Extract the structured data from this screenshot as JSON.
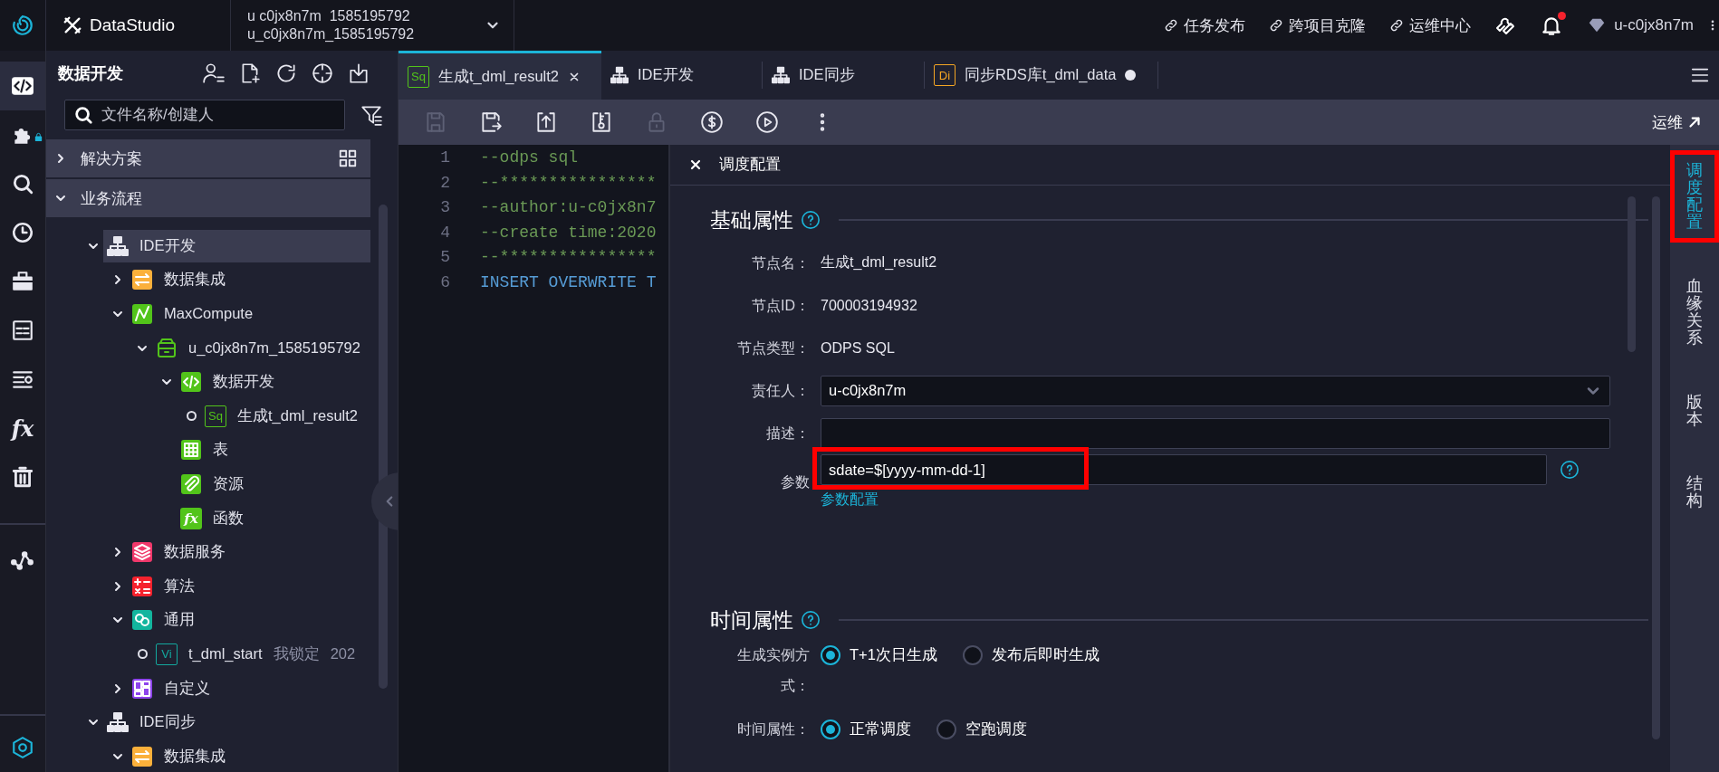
{
  "topbar": {
    "product": "DataStudio",
    "workspace": {
      "name": "u c0jx8n7m  1585195792",
      "id": "u_c0jx8n7m_1585195792"
    },
    "links": [
      {
        "label": "任务发布"
      },
      {
        "label": "跨项目克隆"
      },
      {
        "label": "运维中心"
      }
    ],
    "notification_unread": true,
    "user": "u-c0jx8n7m"
  },
  "rail": {
    "items": [
      {
        "kind": "code",
        "selected": true,
        "locked": false
      },
      {
        "kind": "plugin",
        "selected": false,
        "locked": true
      },
      {
        "kind": "search",
        "selected": false,
        "locked": false
      },
      {
        "kind": "clock",
        "selected": false,
        "locked": false
      },
      {
        "kind": "toolbox",
        "selected": false,
        "locked": false
      },
      {
        "kind": "table",
        "selected": false,
        "locked": false
      },
      {
        "kind": "list",
        "selected": false,
        "locked": false
      },
      {
        "kind": "function",
        "glyph": "fx",
        "selected": false,
        "locked": false
      },
      {
        "kind": "trash",
        "selected": false,
        "locked": false
      }
    ],
    "extra": [
      {
        "kind": "graph"
      }
    ],
    "bottom": [
      {
        "kind": "settings"
      }
    ]
  },
  "sidebar": {
    "title": "数据开发",
    "search": {
      "placeholder": "文件名称/创建人"
    },
    "sections": [
      {
        "label": "解决方案",
        "expanded": false
      },
      {
        "label": "业务流程",
        "expanded": true
      }
    ],
    "tree": [
      {
        "label": "IDE开发",
        "kind": "flow",
        "expanded": true,
        "selected": true,
        "children": [
          {
            "label": "数据集成",
            "kind": "integration",
            "expanded": false,
            "selected": false
          },
          {
            "label": "MaxCompute",
            "kind": "maxcompute",
            "expanded": true,
            "selected": false,
            "children": [
              {
                "label": "u_c0jx8n7m_1585195792",
                "kind": "database",
                "expanded": true,
                "selected": false,
                "children": [
                  {
                    "label": "数据开发",
                    "kind": "code",
                    "expanded": true,
                    "selected": false,
                    "children": [
                      {
                        "label": "生成t_dml_result2",
                        "kind": "file",
                        "badge": "Sq",
                        "color": "#52c41a",
                        "selected": false
                      }
                    ]
                  },
                  {
                    "label": "表",
                    "kind": "table",
                    "selected": false
                  },
                  {
                    "label": "资源",
                    "kind": "resource",
                    "selected": false
                  },
                  {
                    "label": "函数",
                    "kind": "function",
                    "glyph": "fx",
                    "selected": false
                  }
                ]
              }
            ]
          },
          {
            "label": "数据服务",
            "kind": "service",
            "expanded": false,
            "selected": false
          },
          {
            "label": "算法",
            "kind": "algorithm",
            "expanded": false,
            "selected": false
          },
          {
            "label": "通用",
            "kind": "general",
            "expanded": true,
            "selected": false,
            "children": [
              {
                "label": "t_dml_start",
                "kind": "file",
                "badge": "Vi",
                "color": "#13a89e",
                "lock_note": "我锁定",
                "date": "202",
                "selected": false
              }
            ]
          },
          {
            "label": "自定义",
            "kind": "custom",
            "expanded": false,
            "selected": false
          }
        ]
      },
      {
        "label": "IDE同步",
        "kind": "flow",
        "expanded": true,
        "selected": false,
        "children": [
          {
            "label": "数据集成",
            "kind": "integration",
            "expanded": true,
            "selected": false
          }
        ]
      }
    ]
  },
  "editor": {
    "tabs": [
      {
        "label": "生成t_dml_result2",
        "kind": "file",
        "badge": "Sq",
        "color": "#52c41a",
        "selected": true,
        "modified": false
      },
      {
        "label": "IDE开发",
        "kind": "flow",
        "selected": false,
        "modified": false
      },
      {
        "label": "IDE同步",
        "kind": "flow",
        "selected": false,
        "modified": false
      },
      {
        "label": "同步RDS库t_dml_data",
        "kind": "file",
        "badge": "Di",
        "color": "#f5a623",
        "selected": false,
        "modified": true
      }
    ],
    "toolbar": [
      {
        "kind": "save",
        "disabled": true
      },
      {
        "kind": "save-as",
        "disabled": false
      },
      {
        "kind": "submit",
        "disabled": false
      },
      {
        "kind": "key-file",
        "disabled": false
      },
      {
        "kind": "lock",
        "disabled": true
      },
      {
        "kind": "cost",
        "disabled": false
      },
      {
        "kind": "run",
        "disabled": false
      },
      {
        "kind": "more",
        "disabled": false
      }
    ],
    "ops_link": "运维",
    "lines": [
      {
        "number": "1",
        "text": "--odps sql",
        "kind": "comment"
      },
      {
        "number": "2",
        "text": "--****************",
        "kind": "comment"
      },
      {
        "number": "3",
        "text": "--author:u-c0jx8n7",
        "kind": "comment"
      },
      {
        "number": "4",
        "text": "--create time:2020",
        "kind": "comment"
      },
      {
        "number": "5",
        "text": "--****************",
        "kind": "comment"
      },
      {
        "number": "6",
        "text": "INSERT OVERWRITE T",
        "kind": "keyword"
      }
    ]
  },
  "config": {
    "title": "调度配置",
    "sections": [
      {
        "title": "基础属性",
        "fields": [
          {
            "kind": "text",
            "label": "节点名：",
            "value": "生成t_dml_result2"
          },
          {
            "kind": "text",
            "label": "节点ID：",
            "value": "700003194932"
          },
          {
            "kind": "text",
            "label": "节点类型：",
            "value": "ODPS SQL"
          },
          {
            "kind": "select",
            "label": "责任人：",
            "value": "u-c0jx8n7m",
            "help": false,
            "highlighted": false
          },
          {
            "kind": "input",
            "label": "描述：",
            "help": false,
            "highlighted": false
          },
          {
            "kind": "input",
            "label": "参数",
            "value": "sdate=$[yyyy-mm-dd-1]",
            "help": true,
            "highlighted": true,
            "link": "参数配置"
          }
        ]
      },
      {
        "title": "时间属性",
        "fields": [
          {
            "kind": "radio",
            "label": "生成实例方式：",
            "options": [
              {
                "label": "T+1次日生成",
                "selected": true
              },
              {
                "label": "发布后即时生成",
                "selected": false
              }
            ]
          },
          {
            "kind": "radio",
            "label": "时间属性：",
            "options": [
              {
                "label": "正常调度",
                "selected": true
              },
              {
                "label": "空跑调度",
                "selected": false
              }
            ]
          }
        ]
      }
    ]
  },
  "sidetabs": [
    {
      "label": "调度配置",
      "selected": true,
      "highlighted": true
    },
    {
      "label": "血缘关系",
      "selected": false,
      "highlighted": false
    },
    {
      "label": "版本",
      "selected": false,
      "highlighted": false
    },
    {
      "label": "结构",
      "selected": false,
      "highlighted": false
    }
  ]
}
